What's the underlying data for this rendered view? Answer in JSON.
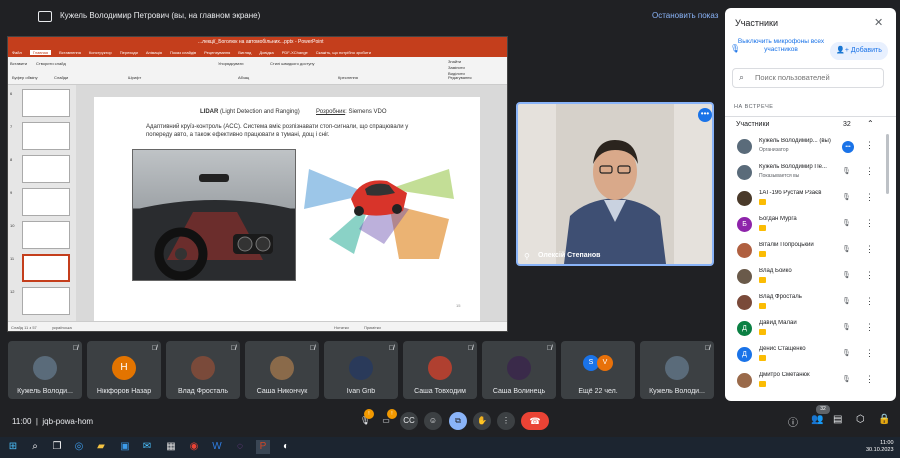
{
  "topbar": {
    "presenting_text": "Кужель Володимир Петрович (вы, на главном экране)",
    "stop_label": "Остановить показ"
  },
  "powerpoint": {
    "title": "...лекції_Боголюк на автомобільних...pptx - PowerPoint",
    "tabs": [
      "Файл",
      "Главная",
      "Вставлення",
      "Конструктор",
      "Переходи",
      "Анімація",
      "Показ слайдів",
      "Рецензування",
      "Вигляд",
      "Довідка",
      "PDF-XChange",
      "Скажіть, що потрібно зробити"
    ],
    "ribbon_groups": [
      "Буфер обміну",
      "Слайди",
      "Шрифт",
      "Абзац",
      "Креслення",
      "Редагування"
    ],
    "ribbon_buttons": [
      "Вставити",
      "Створити слайд",
      "Упорядкувати",
      "Стилі швидкого доступу",
      "Знайти",
      "Замінити",
      "Виділити"
    ],
    "thumb_numbers": [
      "6",
      "7",
      "8",
      "9",
      "10",
      "11",
      "12"
    ],
    "slide": {
      "title_bold": "LIDAR",
      "title_rest": " (Light Detection and Ranging)",
      "developer_label": "Розробник",
      "developer_value": ": Siemens VDO",
      "body": "Адаптивний круїз-контроль (ACC). Система вміє розпізнавати стоп-сигнали, що спрацювали у попереду авто, а також ефективно працювати в тумані, дощ і сніг.",
      "page_number": "15"
    },
    "status": {
      "slide_info": "Слайд 11 з 57",
      "language": "українська",
      "notes": "Нотатки",
      "comments": "Примітки"
    }
  },
  "video": {
    "name": "Олексій Степанов"
  },
  "tiles": [
    {
      "name": "Кужель Володи...",
      "initial": "",
      "color": "#5a6b7a"
    },
    {
      "name": "Нікіфоров Назар",
      "initial": "Н",
      "color": "#e37400"
    },
    {
      "name": "Влад Фросталь",
      "initial": "",
      "color": "#7a4a3a"
    },
    {
      "name": "Саша Никончук",
      "initial": "",
      "color": "#8a6a4a"
    },
    {
      "name": "Ivan Grib",
      "initial": "",
      "color": "#2a3a5a"
    },
    {
      "name": "Саша Товходим",
      "initial": "",
      "color": "#b04030"
    },
    {
      "name": "Саша Волинець",
      "initial": "",
      "color": "#3a2a4a"
    },
    {
      "name": "Ещё 22 чел.",
      "initial": "",
      "color": ""
    },
    {
      "name": "Кужель Володи...",
      "initial": "",
      "color": "#5a6b7a"
    }
  ],
  "more_avatars": [
    "S",
    "V"
  ],
  "bottombar": {
    "time": "11:00",
    "code": "jqb-powa-hom",
    "people_count": "32"
  },
  "panel": {
    "title": "Участники",
    "mute_all": "Выключить микрофоны всех участников",
    "add": "Добавить",
    "search_placeholder": "Поиск пользователей",
    "section": "НА ВСТРЕЧЕ",
    "participants_label": "Участники",
    "participants_count": "32",
    "people": [
      {
        "name": "Кужель Володимир... (вы)",
        "sub": "Организатор",
        "initial": "",
        "color": "#5a6b7a",
        "hand": false
      },
      {
        "name": "Кужель Володимир Пе...",
        "sub": "Показывается вы",
        "initial": "",
        "color": "#5a6b7a",
        "hand": false
      },
      {
        "name": "1АТ-19б Рустам Рзаєв",
        "sub": "",
        "initial": "",
        "color": "#4a3a2a",
        "hand": true
      },
      {
        "name": "Богдан Мурга",
        "sub": "",
        "initial": "Б",
        "color": "#8e24aa",
        "hand": true
      },
      {
        "name": "Віталій Попроцький",
        "sub": "",
        "initial": "",
        "color": "#b06040",
        "hand": true
      },
      {
        "name": "Влад Бойко",
        "sub": "",
        "initial": "",
        "color": "#6a5a4a",
        "hand": true
      },
      {
        "name": "Влад Фросталь",
        "sub": "",
        "initial": "",
        "color": "#7a4a3a",
        "hand": true
      },
      {
        "name": "Давид Малай",
        "sub": "",
        "initial": "Д",
        "color": "#0b8043",
        "hand": true
      },
      {
        "name": "Денис Стащенко",
        "sub": "",
        "initial": "Д",
        "color": "#1a73e8",
        "hand": true
      },
      {
        "name": "Дмитро Сметанюк",
        "sub": "",
        "initial": "",
        "color": "#9a6a4a",
        "hand": true
      }
    ]
  },
  "taskbar": {
    "time": "11:00",
    "date": "30.10.2023"
  }
}
